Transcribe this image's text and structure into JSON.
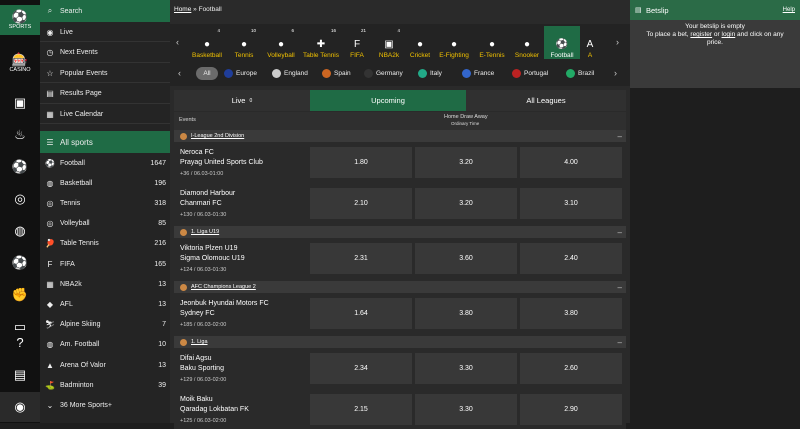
{
  "rail": [
    {
      "label": "SPORTS",
      "icon": "soccer-ball-icon"
    },
    {
      "label": "CASINO",
      "icon": "slot-machine-icon"
    },
    {
      "label": "",
      "icon": "live-tv-icon"
    },
    {
      "label": "",
      "icon": "flame-icon"
    },
    {
      "label": "",
      "icon": "soccer-icon"
    },
    {
      "label": "",
      "icon": "tennis-icon"
    },
    {
      "label": "",
      "icon": "basketball-icon"
    },
    {
      "label": "",
      "icon": "football-icon"
    },
    {
      "label": "",
      "icon": "boxing-icon"
    },
    {
      "label": "",
      "icon": "more-icon"
    },
    {
      "label": "",
      "icon": "help-icon"
    },
    {
      "label": "",
      "icon": "chat-icon"
    },
    {
      "label": "",
      "icon": "globe-icon"
    }
  ],
  "sidebar": {
    "search": "Search",
    "menu": [
      "Live",
      "Next Events",
      "Popular Events",
      "Results Page",
      "Live Calendar"
    ],
    "all_sports": "All sports",
    "sports": [
      {
        "name": "Football",
        "count": "1647"
      },
      {
        "name": "Basketball",
        "count": "196"
      },
      {
        "name": "Tennis",
        "count": "318"
      },
      {
        "name": "Volleyball",
        "count": "85"
      },
      {
        "name": "Table Tennis",
        "count": "216"
      },
      {
        "name": "FIFA",
        "count": "165"
      },
      {
        "name": "NBA2k",
        "count": "13"
      },
      {
        "name": "AFL",
        "count": "13"
      },
      {
        "name": "Alpine Skiing",
        "count": "7"
      },
      {
        "name": "Am. Football",
        "count": "10"
      },
      {
        "name": "Arena Of Valor",
        "count": "13"
      },
      {
        "name": "Badminton",
        "count": "39"
      }
    ],
    "more": "36 More Sports+"
  },
  "breadcrumb": {
    "home": "Home",
    "sep": "»",
    "current": "Football"
  },
  "sport_tabs": [
    {
      "name": "Basketball",
      "count": "4"
    },
    {
      "name": "Tennis",
      "count": "10"
    },
    {
      "name": "Volleyball",
      "count": "6"
    },
    {
      "name": "Table Tennis",
      "count": "16"
    },
    {
      "name": "FIFA",
      "count": "21"
    },
    {
      "name": "NBA2k",
      "count": "4"
    },
    {
      "name": "Cricket",
      "count": ""
    },
    {
      "name": "E-Fighting",
      "count": ""
    },
    {
      "name": "E-Tennis",
      "count": ""
    },
    {
      "name": "Snooker",
      "count": ""
    },
    {
      "name": "Football",
      "count": ""
    },
    {
      "name": "A",
      "count": ""
    }
  ],
  "countries": [
    "All",
    "Europe",
    "England",
    "Spain",
    "Germany",
    "Italy",
    "France",
    "Portugal",
    "Brazil"
  ],
  "tabs": {
    "live": "Live",
    "live_count": "0",
    "upcoming": "Upcoming",
    "all": "All Leagues"
  },
  "header": {
    "events": "Events",
    "market": "Home Draw Away",
    "sub": "Ordinary Time"
  },
  "leagues": [
    {
      "name": "I-League 2nd Division",
      "events": [
        {
          "home": "Neroca FC",
          "away": "Prayag United Sports Club",
          "meta": "+36 / 06.03-01:00",
          "odds": [
            "1.80",
            "3.20",
            "4.00"
          ]
        },
        {
          "home": "Diamond Harbour",
          "away": "Chanmari FC",
          "meta": "+130 / 06.03-01:30",
          "odds": [
            "2.10",
            "3.20",
            "3.10"
          ]
        }
      ]
    },
    {
      "name": "1. Liga U19",
      "events": [
        {
          "home": "Viktoria Plzen U19",
          "away": "Sigma Olomouc U19",
          "meta": "+124 / 06.03-01:30",
          "odds": [
            "2.31",
            "3.60",
            "2.40"
          ]
        }
      ]
    },
    {
      "name": "AFC Champions League 2",
      "events": [
        {
          "home": "Jeonbuk Hyundai Motors FC",
          "away": "Sydney FC",
          "meta": "+185 / 06.03-02:00",
          "odds": [
            "1.64",
            "3.80",
            "3.80"
          ]
        }
      ]
    },
    {
      "name": "1. Liga",
      "events": [
        {
          "home": "Difai Agsu",
          "away": "Baku Sporting",
          "meta": "+129 / 06.03-02:00",
          "odds": [
            "2.34",
            "3.30",
            "2.60"
          ]
        },
        {
          "home": "Moik Baku",
          "away": "Qaradag Lokbatan FK",
          "meta": "+125 / 06.03-02:00",
          "odds": [
            "2.15",
            "3.30",
            "2.90"
          ]
        }
      ]
    }
  ],
  "betslip": {
    "title": "Betslip",
    "help": "Help",
    "empty": "Your betslip is empty",
    "line2": "To place a bet,",
    "register": "register",
    "or": "or",
    "login": "login",
    "line3": "and click on any price."
  }
}
